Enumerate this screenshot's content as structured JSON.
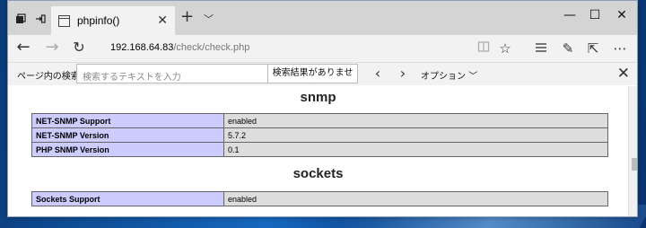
{
  "tab": {
    "title": "phpinfo()"
  },
  "address": {
    "host": "192.168.64.83",
    "path": "/check/check.php"
  },
  "find": {
    "label": "ページ内の検索",
    "placeholder": "検索するテキストを入力",
    "result": "検索結果がありません",
    "options": "オプション"
  },
  "sections": [
    {
      "title": "snmp",
      "rows": [
        {
          "key": "NET-SNMP Support",
          "value": "enabled"
        },
        {
          "key": "NET-SNMP Version",
          "value": "5.7.2"
        },
        {
          "key": "PHP SNMP Version",
          "value": "0.1"
        }
      ]
    },
    {
      "title": "sockets",
      "rows": [
        {
          "key": "Sockets Support",
          "value": "enabled"
        }
      ]
    }
  ],
  "icons": {
    "tab_actions": "tab-actions-icon",
    "set_aside": "set-aside-tabs-icon",
    "page": "page-icon",
    "close": "close-icon",
    "new_tab": "plus-icon",
    "tab_menu": "chevron-down-icon",
    "minimize": "minimize-icon",
    "maximize": "maximize-icon",
    "back": "arrow-left-icon",
    "forward": "arrow-right-icon",
    "refresh": "refresh-icon",
    "reading_view": "book-icon",
    "favorite": "star-icon",
    "hub": "hub-icon",
    "notes": "pen-icon",
    "share": "share-icon",
    "more": "more-icon"
  },
  "colors": {
    "key_cell": "#ccccff",
    "value_cell": "#dddddd",
    "tab_strip": "#d4d4d4",
    "toolbar": "#f2f2f2"
  }
}
